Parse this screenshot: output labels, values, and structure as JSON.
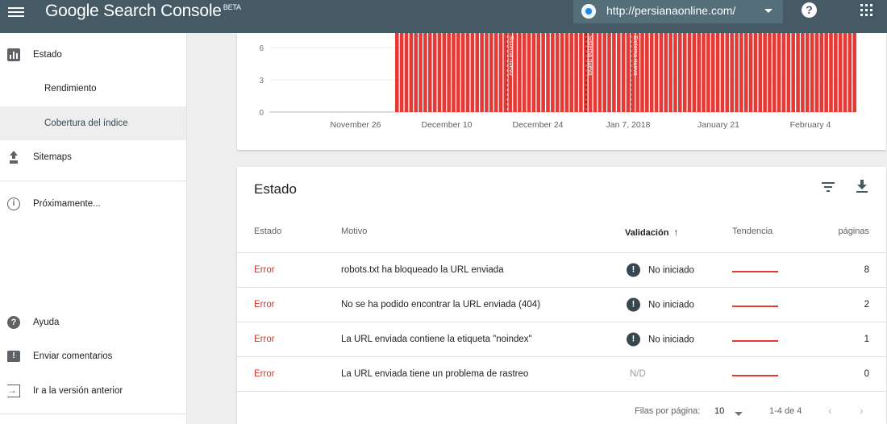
{
  "app": {
    "title": "Google Search Console",
    "badge": "BETA",
    "property_url": "http://persianaonline.com/"
  },
  "sidebar": {
    "items": [
      {
        "label": "Estado",
        "icon": "bar-chart-icon"
      },
      {
        "label": "Rendimiento"
      },
      {
        "label": "Cobertura del índice",
        "active": true
      },
      {
        "label": "Sitemaps",
        "icon": "upload-icon"
      },
      {
        "label": "Próximamente...",
        "icon": "info-icon"
      },
      {
        "label": "Ayuda",
        "icon": "help-icon"
      },
      {
        "label": "Enviar comentarios",
        "icon": "feedback-icon"
      },
      {
        "label": "Ir a la versión anterior",
        "icon": "exit-icon"
      }
    ]
  },
  "chart_data": {
    "type": "bar",
    "ylim": [
      0,
      9
    ],
    "y_ticks": [
      "0",
      "3",
      "6"
    ],
    "x_tick_labels": [
      "November 26",
      "December 10",
      "December 24",
      "Jan 7, 2018",
      "January 21",
      "February 4"
    ],
    "bar_color": "#e53935",
    "bar_start_label_index": 1,
    "value_visible": "above 6 (clipped at top)",
    "annotations": [
      "Sistema nuevo",
      "Sistema nuevo",
      "Sistema nuevo"
    ]
  },
  "table": {
    "title": "Estado",
    "headers": {
      "status": "Estado",
      "reason": "Motivo",
      "validation": "Validación",
      "trend": "Tendencia",
      "pages": "páginas"
    },
    "rows": [
      {
        "status": "Error",
        "reason": "robots.txt ha bloqueado la URL enviada",
        "validation": "No iniciado",
        "validation_icon": true,
        "pages": "8"
      },
      {
        "status": "Error",
        "reason": "No se ha podido encontrar la URL enviada (404)",
        "validation": "No iniciado",
        "validation_icon": true,
        "pages": "2"
      },
      {
        "status": "Error",
        "reason": "La URL enviada contiene la etiqueta \"noindex\"",
        "validation": "No iniciado",
        "validation_icon": true,
        "pages": "1"
      },
      {
        "status": "Error",
        "reason": "La URL enviada tiene un problema de rastreo",
        "validation": "N/D",
        "validation_icon": false,
        "pages": "0"
      }
    ],
    "footer": {
      "rows_per_page_label": "Filas por página:",
      "rows_per_page_value": "10",
      "range": "1-4 de 4",
      "prev": "‹",
      "next": "›"
    }
  },
  "colors": {
    "header": "#455a64",
    "error": "#d93025",
    "bar": "#e53935"
  }
}
